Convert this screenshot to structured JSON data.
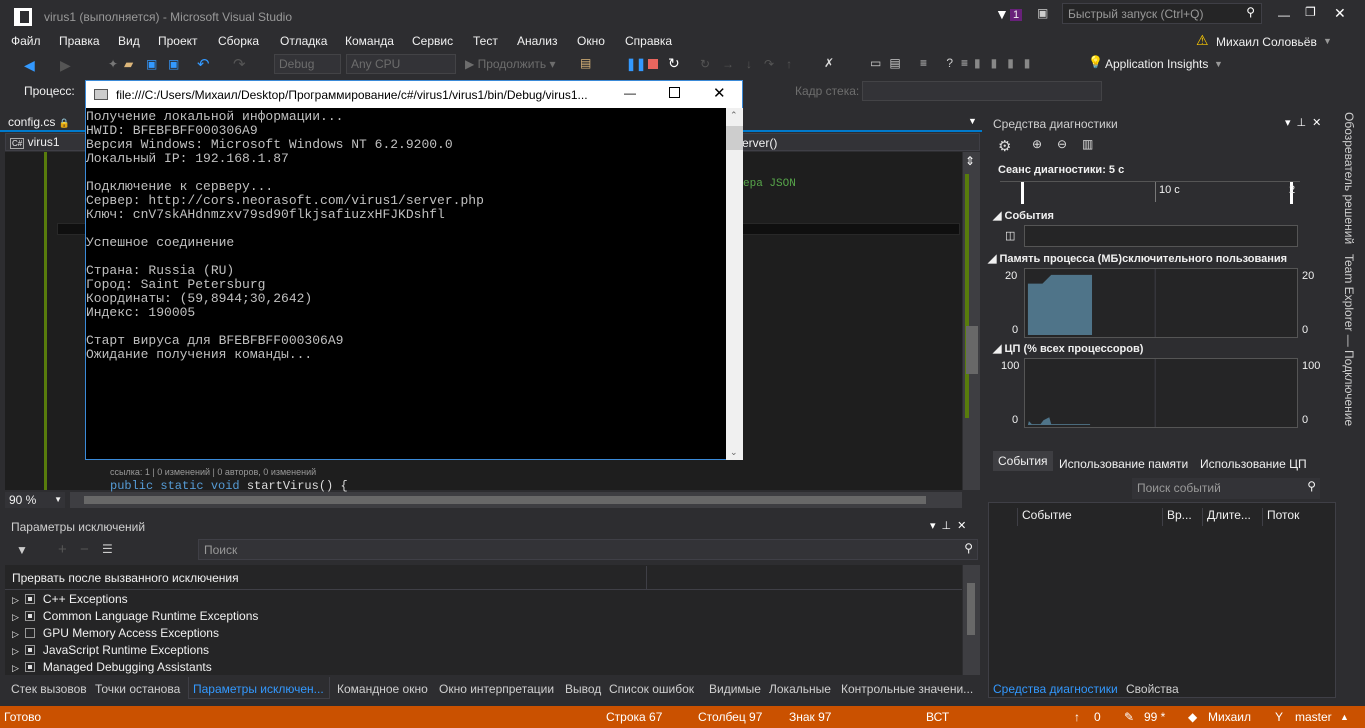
{
  "window": {
    "title": "virus1 (выполняется) - Microsoft Visual Studio",
    "notif_count": "1",
    "quick_launch_placeholder": "Быстрый запуск (Ctrl+Q)",
    "user": "Михаил Соловьёв"
  },
  "menu": [
    "Файл",
    "Правка",
    "Вид",
    "Проект",
    "Сборка",
    "Отладка",
    "Команда",
    "Сервис",
    "Тест",
    "Анализ",
    "Окно",
    "Справка"
  ],
  "toolbar": {
    "config": "Debug",
    "platform": "Any CPU",
    "continue": "Продолжить",
    "app_insights": "Application Insights",
    "process_label": "Процесс:",
    "stack_frame_label": "Кадр стека:"
  },
  "editor": {
    "tab": "config.cs",
    "project": "virus1",
    "member": "erver()",
    "comment_fragment": "ера JSON",
    "codelens": "ссылка: 1 | 0 изменений | 0 авторов, 0 изменений",
    "code_kw": "public static void",
    "code_rest": " startVirus() {",
    "zoom": "90 %"
  },
  "console": {
    "title": "file:///C:/Users/Михаил/Desktop/Программирование/c#/virus1/virus1/bin/Debug/virus1...",
    "lines": [
      "Получение локальной информации...",
      "HWID: BFEBFBFF000306A9",
      "Версия Windows: Microsoft Windows NT 6.2.9200.0",
      "Локальный IP: 192.168.1.87",
      "",
      "Подключение к серверу...",
      "Сервер: http://cors.neorasoft.com/virus1/server.php",
      "Ключ: cnV7skAHdnmzxv79sd90flkjsafiuzxHFJKDshfl",
      "",
      "Успешное соединение",
      "",
      "Страна: Russia (RU)",
      "Город: Saint Petersburg",
      "Координаты: (59,8944;30,2642)",
      "Индекс: 190005",
      "",
      "Старт вируса для BFEBFBFF000306A9",
      "Ожидание получения команды..."
    ]
  },
  "exceptions": {
    "title": "Параметры исключений",
    "search_placeholder": "Поиск",
    "column": "Прервать после вызванного исключения",
    "items": [
      {
        "label": "C++ Exceptions",
        "checked": true
      },
      {
        "label": "Common Language Runtime Exceptions",
        "checked": true
      },
      {
        "label": "GPU Memory Access Exceptions",
        "checked": false
      },
      {
        "label": "JavaScript Runtime Exceptions",
        "checked": true
      },
      {
        "label": "Managed Debugging Assistants",
        "checked": true
      }
    ]
  },
  "bottom_tabs": [
    "Стек вызовов",
    "Точки останова",
    "Параметры исключен...",
    "Командное окно",
    "Окно интерпретации",
    "Вывод",
    "Список ошибок",
    "Видимые",
    "Локальные",
    "Контрольные значени..."
  ],
  "diagnostics": {
    "title": "Средства диагностики",
    "session": "Сеанс диагностики: 5 с",
    "timeline_tick": "10 с",
    "timeline_tick2": "2",
    "events": "События",
    "memory": "Память процесса (МБ)",
    "memory_overflow": "сключительного пользования",
    "memory_max": "20",
    "memory_min": "0",
    "cpu": "ЦП (% всех процессоров)",
    "cpu_max": "100",
    "cpu_min": "0",
    "tabs": [
      "События",
      "Использование памяти",
      "Использование ЦП"
    ],
    "search_placeholder": "Поиск событий",
    "columns": [
      "Событие",
      "Вр...",
      "Длите...",
      "Поток"
    ],
    "bottom_tabs": [
      "Средства диагностики",
      "Свойства"
    ]
  },
  "side_tabs": [
    "Обозреватель решений",
    "Team Explorer — Подключение"
  ],
  "status": {
    "ready": "Готово",
    "line": "Строка 67",
    "col": "Столбец 97",
    "ch": "Знак 97",
    "ins": "ВСТ",
    "push": "0",
    "changes": "99 *",
    "author": "Михаил",
    "branch": "master"
  },
  "colors": {
    "status_bar": "#ca5100",
    "accent": "#007acc",
    "graph_fill": "#4f7489",
    "bg": "#2d2d30"
  }
}
